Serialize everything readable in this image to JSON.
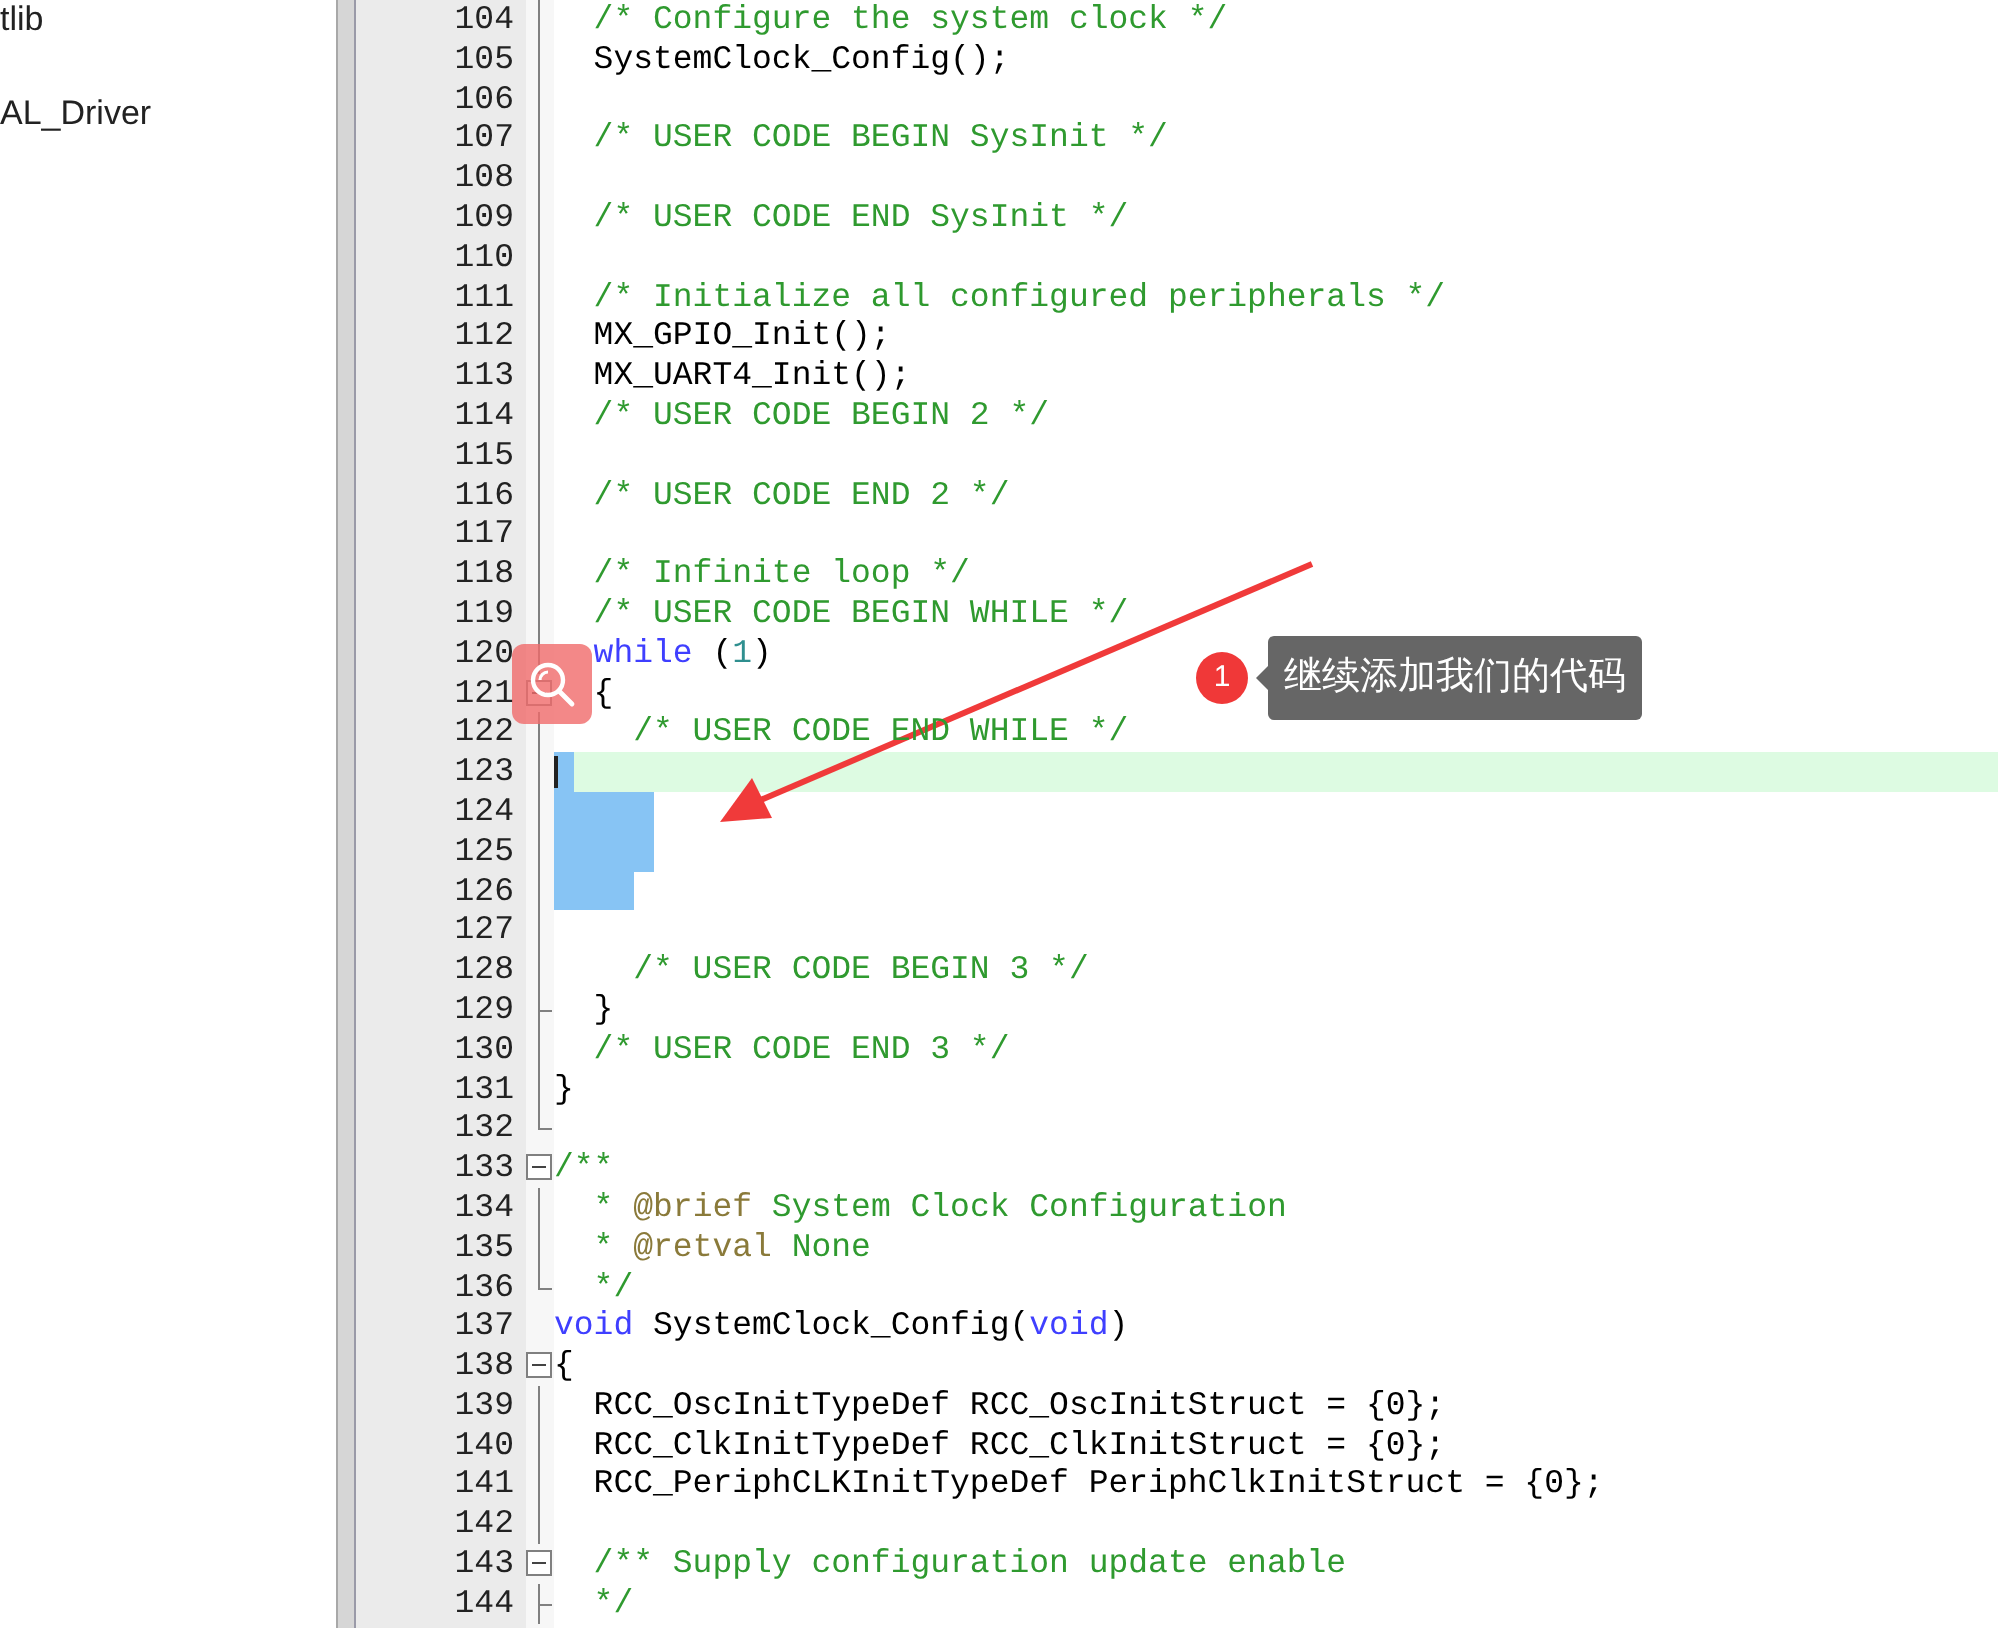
{
  "sidebar": {
    "items": [
      {
        "label": "tlib"
      },
      {
        "label": "AL_Driver"
      }
    ]
  },
  "editor": {
    "lines": [
      {
        "number": "104",
        "kind": "fold-line",
        "current": false,
        "selected": false,
        "segments": [
          {
            "kind": "comment",
            "text": "  /* Configure the system clock */"
          }
        ]
      },
      {
        "number": "105",
        "kind": "fold-line",
        "current": false,
        "selected": false,
        "segments": [
          {
            "kind": "plain",
            "text": "  SystemClock_Config();"
          }
        ]
      },
      {
        "number": "106",
        "kind": "fold-line",
        "current": false,
        "selected": false
      },
      {
        "number": "107",
        "kind": "fold-line",
        "current": false,
        "selected": false,
        "segments": [
          {
            "kind": "comment",
            "text": "  /* USER CODE BEGIN SysInit */"
          }
        ]
      },
      {
        "number": "108",
        "kind": "fold-line",
        "current": false,
        "selected": false
      },
      {
        "number": "109",
        "kind": "fold-line",
        "current": false,
        "selected": false,
        "segments": [
          {
            "kind": "comment",
            "text": "  /* USER CODE END SysInit */"
          }
        ]
      },
      {
        "number": "110",
        "kind": "fold-line",
        "current": false,
        "selected": false
      },
      {
        "number": "111",
        "kind": "fold-line",
        "current": false,
        "selected": false,
        "segments": [
          {
            "kind": "comment",
            "text": "  /* Initialize all configured peripherals */"
          }
        ]
      },
      {
        "number": "112",
        "kind": "fold-line",
        "current": false,
        "selected": false,
        "segments": [
          {
            "kind": "plain",
            "text": "  MX_GPIO_Init();"
          }
        ]
      },
      {
        "number": "113",
        "kind": "fold-line",
        "current": false,
        "selected": false,
        "segments": [
          {
            "kind": "plain",
            "text": "  MX_UART4_Init();"
          }
        ]
      },
      {
        "number": "114",
        "kind": "fold-line",
        "current": false,
        "selected": false,
        "segments": [
          {
            "kind": "comment",
            "text": "  /* USER CODE BEGIN 2 */"
          }
        ]
      },
      {
        "number": "115",
        "kind": "fold-line",
        "current": false,
        "selected": false
      },
      {
        "number": "116",
        "kind": "fold-line",
        "current": false,
        "selected": false,
        "segments": [
          {
            "kind": "comment",
            "text": "  /* USER CODE END 2 */"
          }
        ]
      },
      {
        "number": "117",
        "kind": "fold-line",
        "current": false,
        "selected": false
      },
      {
        "number": "118",
        "kind": "fold-line",
        "current": false,
        "selected": false,
        "segments": [
          {
            "kind": "comment",
            "text": "  /* Infinite loop */"
          }
        ]
      },
      {
        "number": "119",
        "kind": "fold-line",
        "current": false,
        "selected": false,
        "segments": [
          {
            "kind": "comment",
            "text": "  /* USER CODE BEGIN WHILE */"
          }
        ]
      },
      {
        "number": "120",
        "kind": "fold-line",
        "current": false,
        "selected": false,
        "segments": [
          {
            "kind": "keyword",
            "text": "  while"
          },
          {
            "kind": "plain",
            "text": " ("
          },
          {
            "kind": "number",
            "text": "1"
          },
          {
            "kind": "plain",
            "text": ")"
          }
        ]
      },
      {
        "number": "121",
        "kind": "fold-start",
        "current": false,
        "selected": false,
        "segments": [
          {
            "kind": "plain",
            "text": "  {"
          }
        ]
      },
      {
        "number": "122",
        "kind": "fold-line",
        "current": false,
        "selected": false,
        "segments": [
          {
            "kind": "comment",
            "text": "    /* USER CODE END WHILE */"
          }
        ]
      },
      {
        "number": "123",
        "kind": "fold-line",
        "current": true,
        "selected": true
      },
      {
        "number": "124",
        "kind": "fold-line",
        "current": false,
        "selected": true
      },
      {
        "number": "125",
        "kind": "fold-line",
        "current": false,
        "selected": true
      },
      {
        "number": "126",
        "kind": "fold-line",
        "current": false,
        "selected": true
      },
      {
        "number": "127",
        "kind": "fold-line",
        "current": false,
        "selected": false
      },
      {
        "number": "128",
        "kind": "fold-line",
        "current": false,
        "selected": false,
        "segments": [
          {
            "kind": "comment",
            "text": "    /* USER CODE BEGIN 3 */"
          }
        ]
      },
      {
        "number": "129",
        "kind": "fold-tick",
        "current": false,
        "selected": false,
        "segments": [
          {
            "kind": "plain",
            "text": "  }"
          }
        ]
      },
      {
        "number": "130",
        "kind": "fold-line",
        "current": false,
        "selected": false,
        "segments": [
          {
            "kind": "comment",
            "text": "  /* USER CODE END 3 */"
          }
        ]
      },
      {
        "number": "131",
        "kind": "fold-line",
        "current": false,
        "selected": false,
        "segments": [
          {
            "kind": "plain",
            "text": "}"
          }
        ]
      },
      {
        "number": "132",
        "kind": "fold-end",
        "current": false,
        "selected": false
      },
      {
        "number": "133",
        "kind": "fold-start",
        "current": false,
        "selected": false,
        "segments": [
          {
            "kind": "comment",
            "text": "/**"
          }
        ]
      },
      {
        "number": "134",
        "kind": "fold-line",
        "current": false,
        "selected": false,
        "segments": [
          {
            "kind": "comment",
            "text": "  * "
          },
          {
            "kind": "doctag",
            "text": "@brief"
          },
          {
            "kind": "comment",
            "text": " System Clock Configuration"
          }
        ]
      },
      {
        "number": "135",
        "kind": "fold-line",
        "current": false,
        "selected": false,
        "segments": [
          {
            "kind": "comment",
            "text": "  * "
          },
          {
            "kind": "doctag",
            "text": "@retval"
          },
          {
            "kind": "comment",
            "text": " None"
          }
        ]
      },
      {
        "number": "136",
        "kind": "fold-end",
        "current": false,
        "selected": false,
        "segments": [
          {
            "kind": "comment",
            "text": "  */"
          }
        ]
      },
      {
        "number": "137",
        "kind": "plain",
        "current": false,
        "selected": false,
        "segments": [
          {
            "kind": "keyword",
            "text": "void"
          },
          {
            "kind": "plain",
            "text": " SystemClock_Config("
          },
          {
            "kind": "keyword",
            "text": "void"
          },
          {
            "kind": "plain",
            "text": ")"
          }
        ]
      },
      {
        "number": "138",
        "kind": "fold-start",
        "current": false,
        "selected": false,
        "segments": [
          {
            "kind": "plain",
            "text": "{"
          }
        ]
      },
      {
        "number": "139",
        "kind": "fold-line",
        "current": false,
        "selected": false,
        "segments": [
          {
            "kind": "plain",
            "text": "  RCC_OscInitTypeDef RCC_OscInitStruct = {0};"
          }
        ]
      },
      {
        "number": "140",
        "kind": "fold-line",
        "current": false,
        "selected": false,
        "segments": [
          {
            "kind": "plain",
            "text": "  RCC_ClkInitTypeDef RCC_ClkInitStruct = {0};"
          }
        ]
      },
      {
        "number": "141",
        "kind": "fold-line",
        "current": false,
        "selected": false,
        "segments": [
          {
            "kind": "plain",
            "text": "  RCC_PeriphCLKInitTypeDef PeriphClkInitStruct = {0};"
          }
        ]
      },
      {
        "number": "142",
        "kind": "fold-line",
        "current": false,
        "selected": false
      },
      {
        "number": "143",
        "kind": "fold-start",
        "current": false,
        "selected": false,
        "segments": [
          {
            "kind": "comment",
            "text": "  /** Supply configuration update enable"
          }
        ]
      },
      {
        "number": "144",
        "kind": "fold-tick",
        "current": false,
        "selected": false,
        "segments": [
          {
            "kind": "comment",
            "text": "  */"
          }
        ]
      }
    ]
  },
  "annotation": {
    "badge": "1",
    "text": "继续添加我们的代码"
  }
}
